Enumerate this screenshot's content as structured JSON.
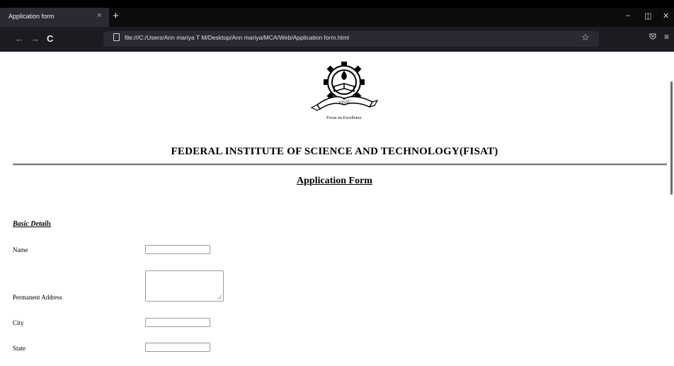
{
  "browser": {
    "tab_title": "Application form",
    "tab_close": "×",
    "new_tab": "+",
    "url": "file:///C:/Users/Ann mariya T M/Desktop/Ann mariya/MCA/Web/Application form.html",
    "back": "←",
    "forward": "→",
    "reload": "C",
    "bookmark_star": "☆",
    "minimize": "–",
    "restore": "◫",
    "close": "✕",
    "menu": "≡"
  },
  "header": {
    "logo_caption": "Focus on Excellence",
    "logo_banner": "FISAT",
    "institute": "FEDERAL INSTITUTE OF SCIENCE AND TECHNOLOGY(FISAT)"
  },
  "form": {
    "title": "Application Form",
    "section": "Basic Details",
    "fields": [
      {
        "label": "Name",
        "value": ""
      },
      {
        "label": "Permanent Address",
        "value": ""
      },
      {
        "label": "City",
        "value": ""
      },
      {
        "label": "State",
        "value": ""
      }
    ]
  }
}
